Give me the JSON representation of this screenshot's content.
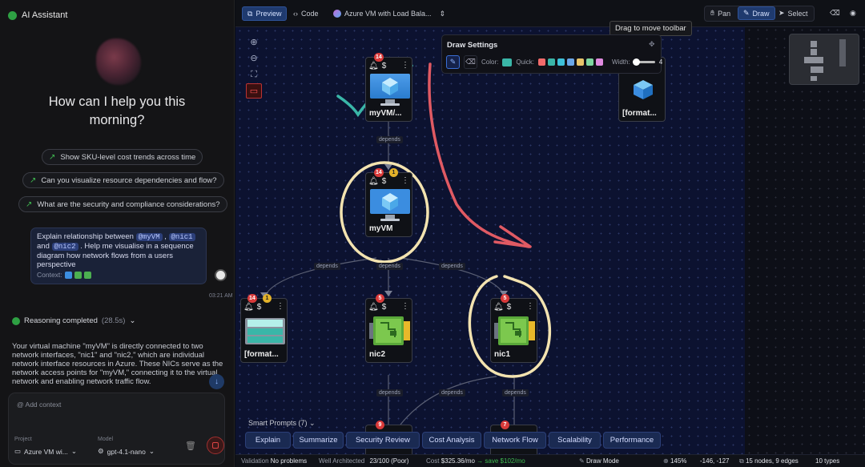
{
  "assistant": {
    "title": "AI Assistant",
    "greeting": "How can I help you this morning?",
    "suggestions": [
      "Show SKU-level cost trends across time",
      "Can you visualize resource dependencies and flow?",
      "What are the security and compliance considerations?"
    ],
    "user_message": {
      "p1": "Explain relationship between ",
      "m1": "@myVM",
      "p2": " ,",
      "m2": "@nic1",
      "p3": " and ",
      "m3": "@nic2",
      "p4": " . Help me visualise in a sequence diagram how network flows from a users perspective",
      "context_label": "Context:"
    },
    "time": "03:21 AM",
    "reasoning": "Reasoning completed",
    "reasoning_duration": "(28.5s)",
    "reply": "Your virtual machine \"myVM\" is directly connected to two network interfaces, \"nic1\" and \"nic2,\" which are individual network interface resources in Azure. These NICs serve as the network access points for \"myVM,\" connecting it to the virtual network and enabling network traffic flow.",
    "input_placeholder": "Add context",
    "project_label": "Project",
    "project_value": "Azure VM wi...",
    "model_label": "Model",
    "model_value": "gpt-4.1-nano"
  },
  "toolbar": {
    "preview": "Preview",
    "code": "Code",
    "diagram_name": "Azure VM with Load Bala...",
    "pan": "Pan",
    "draw": "Draw",
    "select": "Select",
    "tooltip": "Drag to move toolbar"
  },
  "draw_settings": {
    "title": "Draw Settings",
    "color_label": "Color:",
    "quick_label": "Quick:",
    "width_label": "Width:",
    "width_value": "4",
    "current_color": "#3ab6a8",
    "quick_colors": [
      "#f26b6b",
      "#3ab6a8",
      "#3ec1d9",
      "#6aa7e8",
      "#e8c46a",
      "#7fd6a0",
      "#e08be0"
    ]
  },
  "nodes": [
    {
      "label": "myVM/...",
      "alerts": "14",
      "warnings": ""
    },
    {
      "label": "[format...",
      "alerts": "",
      "warnings": ""
    },
    {
      "label": "myVM",
      "alerts": "14",
      "warnings": "1"
    },
    {
      "label": "[format...",
      "alerts": "14",
      "warnings": "1"
    },
    {
      "label": "nic2",
      "alerts": "5",
      "warnings": ""
    },
    {
      "label": "nic1",
      "alerts": "5",
      "warnings": ""
    },
    {
      "label": "",
      "alerts": "9",
      "warnings": ""
    },
    {
      "label": "",
      "alerts": "7",
      "warnings": ""
    }
  ],
  "edge_label": "depends",
  "smart_prompts": {
    "title": "Smart Prompts (7)",
    "buttons": [
      "Explain",
      "Summarize",
      "Security Review",
      "Cost Analysis",
      "Network Flow",
      "Scalability",
      "Performance"
    ]
  },
  "status": {
    "validation_label": "Validation",
    "validation_value": "No problems",
    "wa_label": "Well Architected",
    "wa_value": "23/100 (Poor)",
    "cost_label": "Cost",
    "cost_value": "$325.36/mo",
    "save": "save $102/mo",
    "mode": "Draw Mode",
    "zoom": "145%",
    "coords": "-146, -127",
    "counts": "15 nodes, 9 edges",
    "types": "10 types"
  },
  "colors": {
    "accent": "#2e5298",
    "annotation_red": "#e05a63",
    "annotation_teal": "#3ab6a8",
    "annotation_yellow": "#f3e3b0"
  }
}
